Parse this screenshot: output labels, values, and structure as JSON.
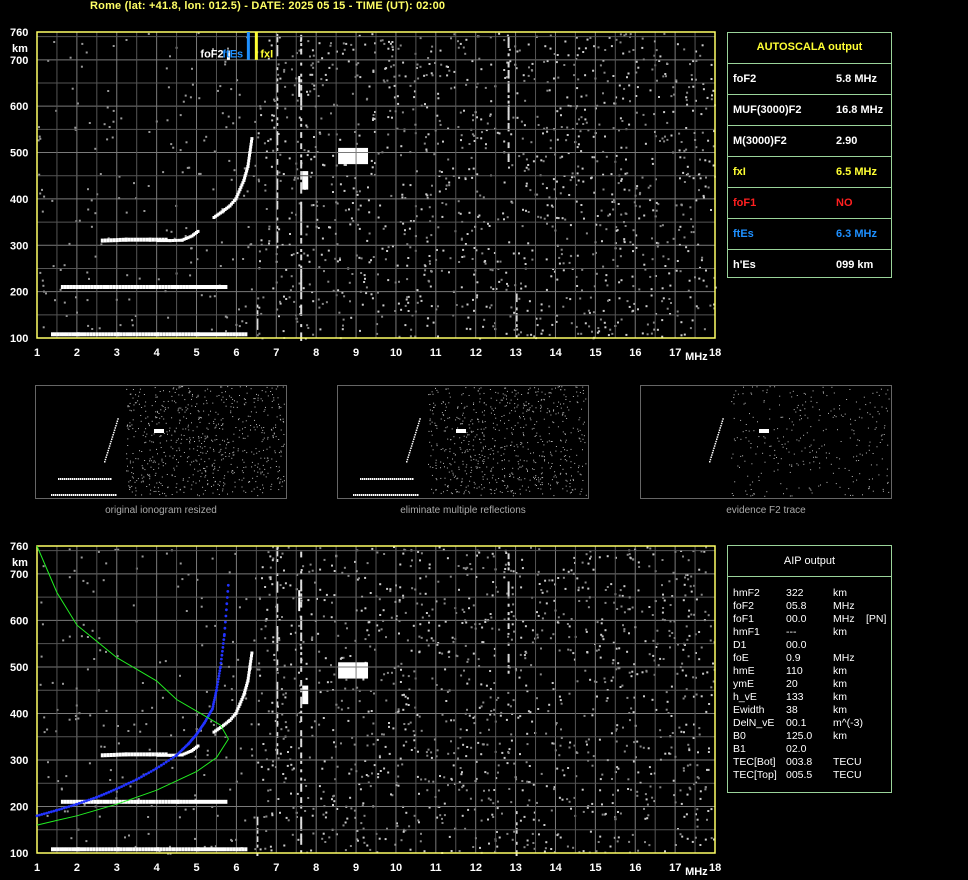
{
  "header": {
    "title": "Rome (lat: +41.8, lon: 012.5) - DATE: 2025 05 15 - TIME (UT): 02:00"
  },
  "colors": {
    "frame": "#ffff66",
    "grid": "#7a7a7a",
    "panel_border": "#9ad39a",
    "foF2": "#ffffff",
    "ftEs": "#1e90ff",
    "fxI": "#ffff33",
    "foF1": "#ff2020",
    "profile_blue": "#2233ff",
    "profile_green": "#22ee22"
  },
  "axes": {
    "y_unit": "km",
    "x_unit": "MHz",
    "y_ticks": [
      "760",
      "700",
      "600",
      "500",
      "400",
      "300",
      "200",
      "100"
    ],
    "x_ticks": [
      "1",
      "2",
      "3",
      "4",
      "5",
      "6",
      "7",
      "8",
      "9",
      "10",
      "11",
      "12",
      "13",
      "14",
      "15",
      "16",
      "17",
      "18"
    ]
  },
  "markers": {
    "foF2_label": "foF2",
    "ftEs_label": "ftEs",
    "fxI_label": "fxI"
  },
  "autoscala": {
    "title": "AUTOSCALA output",
    "rows": [
      {
        "key": "foF2",
        "value": "5.8 MHz",
        "color": "#ffffff"
      },
      {
        "key": "MUF(3000)F2",
        "value": "16.8 MHz",
        "color": "#ffffff"
      },
      {
        "key": "M(3000)F2",
        "value": "2.90",
        "color": "#ffffff"
      },
      {
        "key": "fxI",
        "value": "6.5 MHz",
        "color": "#ffff33"
      },
      {
        "key": "foF1",
        "value": "NO",
        "color": "#ff2020"
      },
      {
        "key": "ftEs",
        "value": "6.3 MHz",
        "color": "#1e90ff"
      },
      {
        "key": "h'Es",
        "value": "099    km",
        "color": "#ffffff"
      }
    ]
  },
  "thumbnails": [
    {
      "caption": "original ionogram resized"
    },
    {
      "caption": "eliminate multiple reflections"
    },
    {
      "caption": "evidence F2 trace"
    }
  ],
  "aip": {
    "title": "AIP output",
    "rows": [
      [
        "hmF2",
        "322",
        "km",
        ""
      ],
      [
        "foF2",
        "05.8",
        "MHz",
        ""
      ],
      [
        "foF1",
        "00.0",
        "MHz",
        "[PN]"
      ],
      [
        "hmF1",
        "---",
        "km",
        ""
      ],
      [
        "D1",
        "00.0",
        "",
        ""
      ],
      [
        "foE",
        "0.9",
        "MHz",
        ""
      ],
      [
        "hmE",
        "110",
        "km",
        ""
      ],
      [
        "ymE",
        "20",
        "km",
        ""
      ],
      [
        "h_vE",
        "133",
        "km",
        ""
      ],
      [
        "Ewidth",
        "38",
        "km",
        ""
      ],
      [
        "DelN_vE",
        "00.1",
        "m^(-3)",
        ""
      ],
      [
        "B0",
        "125.0",
        "km",
        ""
      ],
      [
        "B1",
        "02.0",
        "",
        ""
      ],
      [
        "TEC[Bot]",
        "003.8",
        "TECU",
        ""
      ],
      [
        "TEC[Top]",
        "005.5",
        "TECU",
        ""
      ]
    ]
  },
  "chart_data": [
    {
      "type": "scatter",
      "title": "",
      "xlabel": "MHz",
      "ylabel": "km",
      "xlim": [
        1,
        18
      ],
      "ylim": [
        100,
        760
      ],
      "grid": true,
      "series": [
        {
          "name": "foF2",
          "points": [
            [
              5.8,
              720
            ],
            [
              5.8,
              700
            ]
          ]
        },
        {
          "name": "ftEs",
          "points": [
            [
              6.3,
              760
            ],
            [
              6.3,
              700
            ]
          ]
        },
        {
          "name": "fxI",
          "points": [
            [
              6.5,
              760
            ],
            [
              6.5,
              700
            ]
          ]
        }
      ],
      "traces": {
        "F2_trace": [
          [
            5.4,
            360
          ],
          [
            5.6,
            372
          ],
          [
            5.8,
            385
          ],
          [
            5.95,
            400
          ],
          [
            6.05,
            420
          ],
          [
            6.15,
            440
          ],
          [
            6.25,
            470
          ],
          [
            6.3,
            500
          ],
          [
            6.35,
            530
          ]
        ],
        "F2_second_hop": [
          [
            4.0,
            310
          ],
          [
            4.3,
            310
          ],
          [
            4.6,
            311
          ],
          [
            4.85,
            320
          ],
          [
            5.0,
            330
          ]
        ],
        "Es_first": [
          [
            1.35,
            108
          ],
          [
            2.0,
            108
          ],
          [
            3.0,
            108
          ],
          [
            4.0,
            108
          ],
          [
            5.0,
            108
          ],
          [
            6.2,
            108
          ]
        ],
        "Es_second": [
          [
            1.6,
            210
          ],
          [
            2.5,
            210
          ],
          [
            3.5,
            210
          ],
          [
            4.5,
            210
          ],
          [
            5.7,
            210
          ]
        ],
        "Es_third": [
          [
            2.6,
            310
          ],
          [
            3.2,
            312
          ],
          [
            3.8,
            312
          ],
          [
            4.2,
            312
          ]
        ]
      }
    },
    {
      "type": "line",
      "title": "",
      "xlabel": "MHz",
      "ylabel": "km",
      "xlim": [
        1,
        18
      ],
      "ylim": [
        100,
        760
      ],
      "grid": true,
      "series": [
        {
          "name": "",
          "color": "#2233ff",
          "x": [
            1.0,
            1.5,
            2.0,
            2.5,
            3.0,
            3.5,
            4.0,
            4.5,
            4.8,
            5.0,
            5.2,
            5.4,
            5.5,
            5.6,
            5.7,
            5.8
          ],
          "y": [
            180,
            192,
            205,
            220,
            238,
            258,
            282,
            310,
            335,
            355,
            380,
            410,
            450,
            500,
            570,
            680
          ]
        },
        {
          "name": "",
          "color": "#22ee22",
          "x": [
            1.0,
            1.5,
            2.0,
            3.0,
            4.0,
            5.0,
            5.5,
            5.8,
            5.6,
            5.0,
            4.5,
            4.0,
            3.0,
            2.0,
            1.5,
            1.0
          ],
          "y": [
            160,
            170,
            180,
            205,
            235,
            275,
            305,
            345,
            375,
            405,
            430,
            470,
            520,
            590,
            660,
            760
          ]
        }
      ]
    }
  ]
}
